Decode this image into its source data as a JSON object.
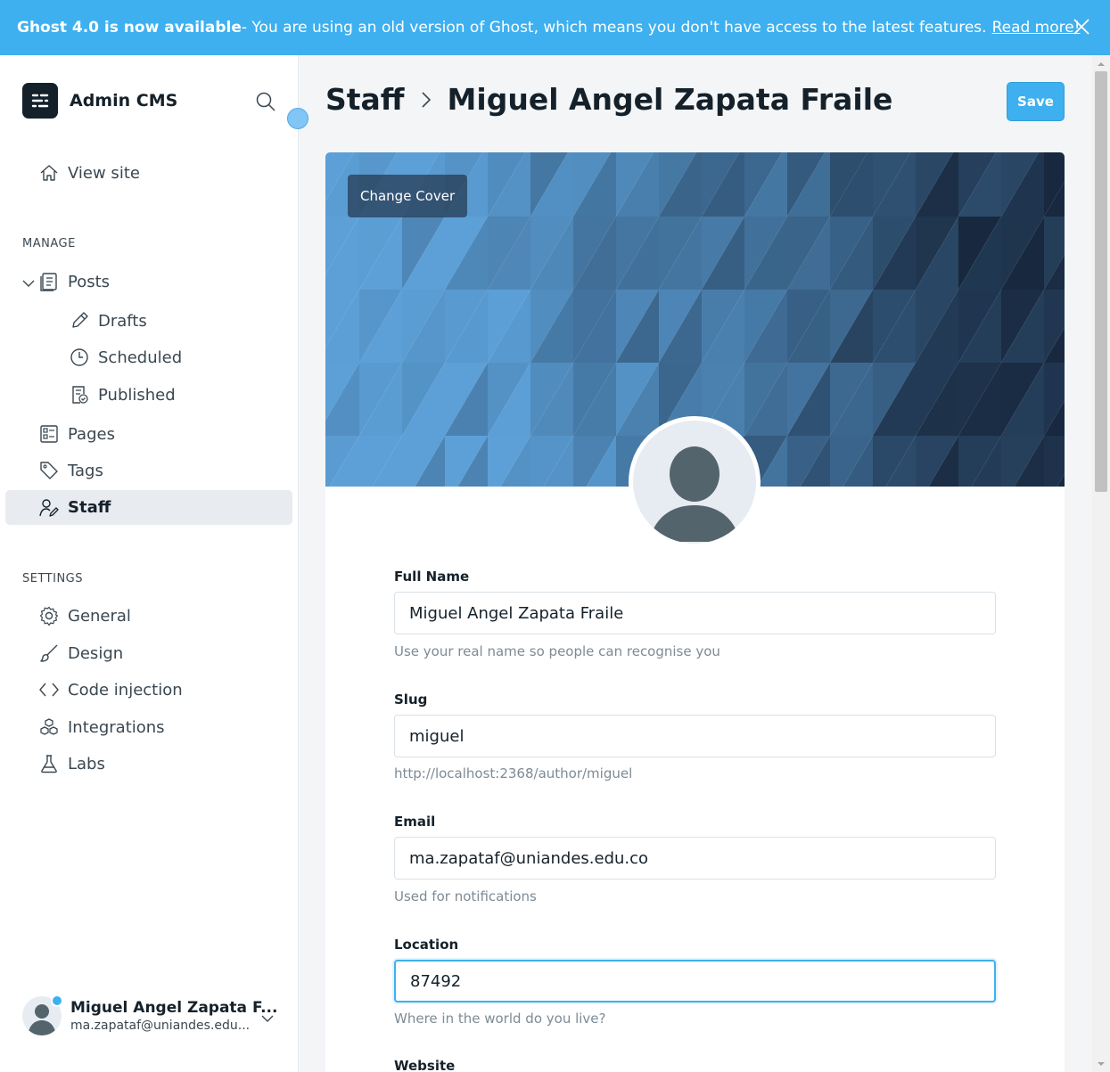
{
  "banner": {
    "title": "Ghost 4.0 is now available",
    "message": " - You are using an old version of Ghost, which means you don't have access to the latest features.",
    "link": "Read more!"
  },
  "sidebar": {
    "brand": "Admin CMS",
    "view_site": "View site",
    "manage_label": "MANAGE",
    "posts": "Posts",
    "drafts": "Drafts",
    "scheduled": "Scheduled",
    "published": "Published",
    "pages": "Pages",
    "tags": "Tags",
    "staff": "Staff",
    "settings_label": "SETTINGS",
    "general": "General",
    "design": "Design",
    "code_injection": "Code injection",
    "integrations": "Integrations",
    "labs": "Labs",
    "user_name": "Miguel Angel Zapata F...",
    "user_email": "ma.zapataf@uniandes.edu..."
  },
  "header": {
    "crumb_root": "Staff",
    "crumb_current": "Miguel Angel Zapata Fraile",
    "save": "Save"
  },
  "cover": {
    "change_cover": "Change Cover"
  },
  "form": {
    "full_name_label": "Full Name",
    "full_name_value": "Miguel Angel Zapata Fraile",
    "full_name_help": "Use your real name so people can recognise you",
    "slug_label": "Slug",
    "slug_value": "miguel",
    "slug_help": "http://localhost:2368/author/miguel",
    "email_label": "Email",
    "email_value": "ma.zapataf@uniandes.edu.co",
    "email_help": "Used for notifications",
    "location_label": "Location",
    "location_value": "87492",
    "location_help": "Where in the world do you live?",
    "website_label": "Website"
  },
  "colors": {
    "accent": "#3eb0ef",
    "sidebar_active": "#e8ebf0",
    "text": "#15212a"
  }
}
